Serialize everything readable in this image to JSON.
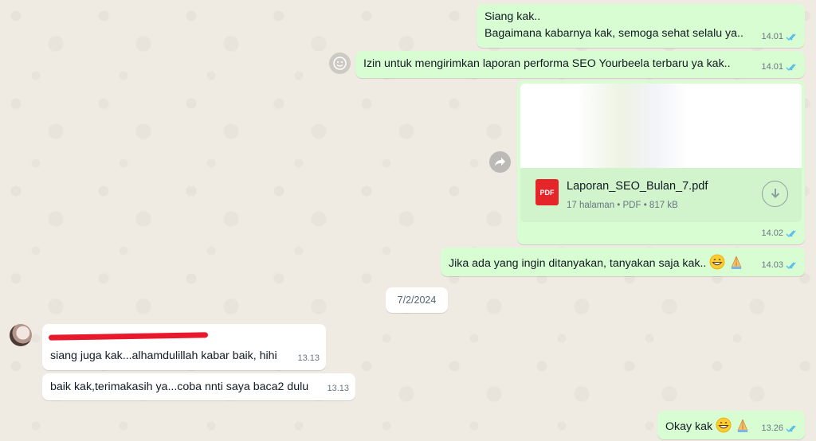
{
  "colors": {
    "outgoing_bubble": "#d9fdd3",
    "incoming_bubble": "#ffffff",
    "read_ticks": "#53bdeb",
    "chat_background": "#efeae2",
    "pdf_red": "#e5252a"
  },
  "messages": [
    {
      "direction": "out",
      "lines": [
        "Siang kak..",
        "Bagaimana kabarnya kak, semoga sehat selalu ya.."
      ],
      "time": "14.01",
      "status": "read"
    },
    {
      "direction": "out",
      "text": "Izin untuk mengirimkan laporan performa SEO Yourbeela terbaru ya kak..",
      "time": "14.01",
      "status": "read"
    },
    {
      "direction": "out",
      "type": "document",
      "file_name": "Laporan_SEO_Bulan_7.pdf",
      "file_info": "17 halaman • PDF • 817 kB",
      "file_badge": "PDF",
      "time": "14.02",
      "status": "read"
    },
    {
      "direction": "out",
      "text": "Jika ada yang ingin ditanyakan, tanyakan saja kak..",
      "emojis": [
        "grinning-face-emoji",
        "folded-hands-emoji"
      ],
      "time": "14.03",
      "status": "read"
    },
    {
      "direction": "in",
      "sender_redacted": true,
      "text": "siang juga kak...alhamdulillah kabar baik, hihi",
      "time": "13.13"
    },
    {
      "direction": "in",
      "text": "baik kak,terimakasih ya...coba nnti saya baca2 dulu",
      "time": "13.13"
    },
    {
      "direction": "out",
      "text": "Okay kak",
      "emojis": [
        "grinning-face-emoji",
        "folded-hands-emoji"
      ],
      "time": "13.26",
      "status": "read"
    }
  ],
  "date_divider": "7/2/2024",
  "icons": {
    "forward": "forward-arrow-icon",
    "reaction": "emoji-smile-icon",
    "download": "download-icon",
    "read_receipt": "double-check-icon"
  }
}
